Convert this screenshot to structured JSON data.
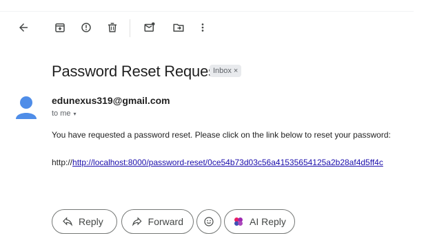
{
  "toolbar": {
    "icons": [
      "back-arrow-icon",
      "archive-icon",
      "report-spam-icon",
      "delete-icon",
      "mark-unread-icon",
      "move-to-icon",
      "more-options-icon"
    ]
  },
  "email": {
    "subject": "Password Reset Request",
    "label": "Inbox",
    "label_close": "×",
    "sender": "edunexus319@gmail.com",
    "to": "to me",
    "to_caret": "▾",
    "body_text": "You have requested a password reset. Please click on the link below to reset your password:",
    "url_prefix": "http://",
    "url_link": "http://localhost:8000/password-reset/0ce54b73d03c56a41535654125a2b28af4d5ff4c"
  },
  "actions": {
    "reply": "Reply",
    "forward": "Forward",
    "ai_reply": "AI Reply"
  },
  "colors": {
    "avatar": "#4f8de8",
    "link": "#1a0dab",
    "ai_accent": "#9c27b0"
  }
}
